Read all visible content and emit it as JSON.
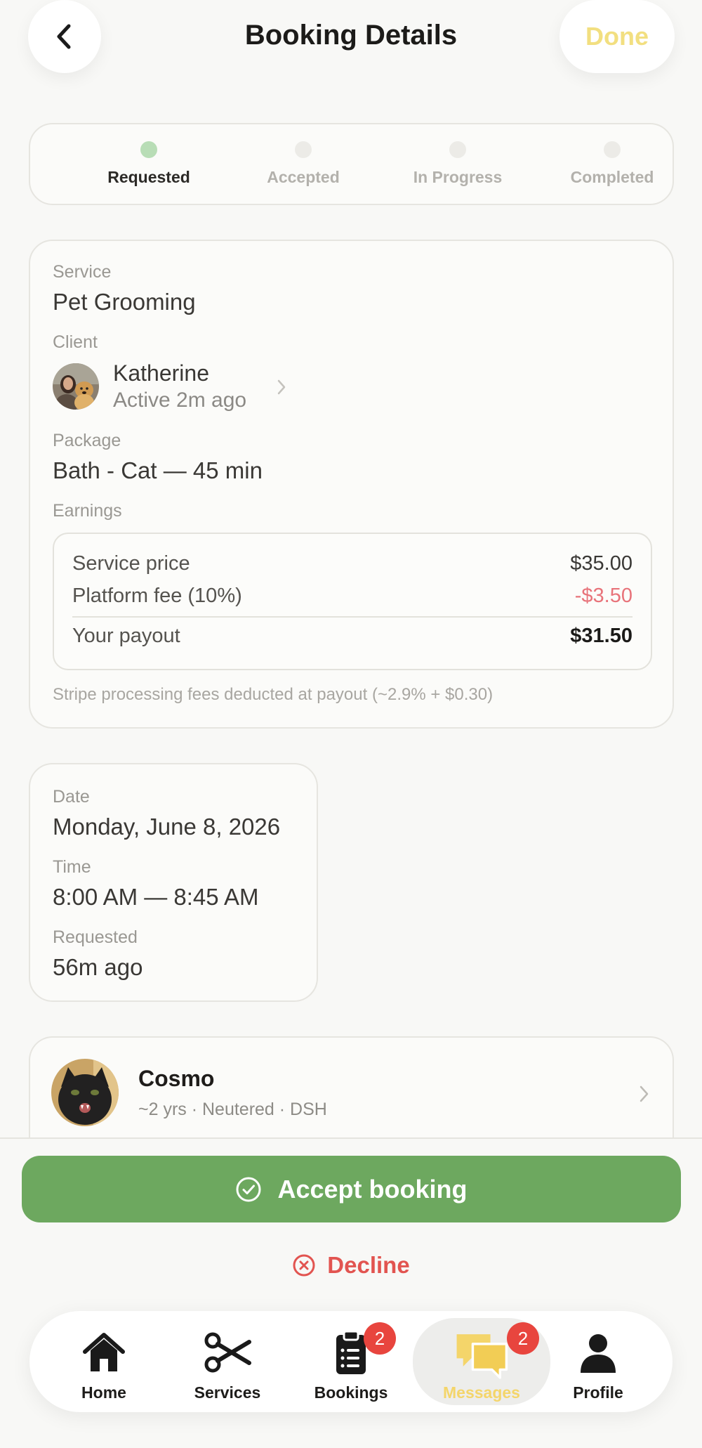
{
  "header": {
    "title": "Booking Details",
    "done_label": "Done"
  },
  "stepper": [
    {
      "label": "Requested",
      "active": true
    },
    {
      "label": "Accepted",
      "active": false
    },
    {
      "label": "In Progress",
      "active": false
    },
    {
      "label": "Completed",
      "active": false
    }
  ],
  "details": {
    "service_label": "Service",
    "service_value": "Pet Grooming",
    "client_label": "Client",
    "client_name": "Katherine",
    "client_status": "Active 2m ago",
    "package_label": "Package",
    "package_value": "Bath - Cat — 45 min",
    "earnings_label": "Earnings",
    "earnings": {
      "service_price_label": "Service price",
      "service_price": "$35.00",
      "platform_fee_label": "Platform fee (10%)",
      "platform_fee": "-$3.50",
      "payout_label": "Your payout",
      "payout": "$31.50"
    },
    "stripe_note": "Stripe processing fees deducted at payout (~2.9% + $0.30)"
  },
  "schedule": {
    "date_label": "Date",
    "date_value": "Monday, June 8, 2026",
    "time_label": "Time",
    "time_value": "8:00 AM — 8:45 AM",
    "requested_label": "Requested",
    "requested_value": "56m ago"
  },
  "pet": {
    "name": "Cosmo",
    "meta": "~2 yrs · Neutered · DSH"
  },
  "actions": {
    "accept_label": "Accept booking",
    "decline_label": "Decline"
  },
  "tabbar": {
    "home": "Home",
    "services": "Services",
    "bookings": "Bookings",
    "bookings_badge": "2",
    "messages": "Messages",
    "messages_badge": "2",
    "profile": "Profile"
  },
  "colors": {
    "accent_green": "#6da85f",
    "done_yellow": "#f2df80",
    "decline_red": "#e25450",
    "fee_red": "#e8737a",
    "badge_red": "#e8453e",
    "messages_yellow": "#f4d56a"
  },
  "icons": {
    "back": "chevron-left-icon",
    "home": "house-icon",
    "services": "scissors-icon",
    "bookings": "clipboard-list-icon",
    "messages": "chat-bubbles-icon",
    "profile": "person-icon"
  }
}
